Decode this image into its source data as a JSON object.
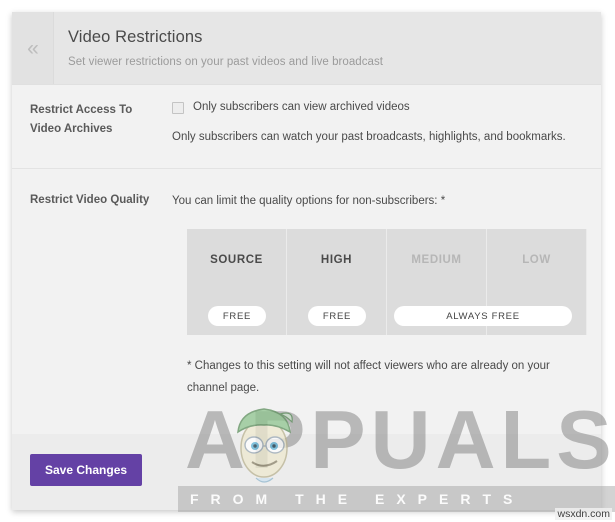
{
  "panel": {
    "title": "Video Restrictions",
    "subtitle": "Set viewer restrictions on your past videos and live broadcast",
    "collapse_icon": "double-chevron-left",
    "collapse_glyph": "«"
  },
  "sections": {
    "archives": {
      "label": "Restrict Access To Video Archives",
      "checkbox_label": "Only subscribers can view archived videos",
      "checkbox_checked": false,
      "help_text": "Only subscribers can watch your past broadcasts, highlights, and bookmarks."
    },
    "quality": {
      "label": "Restrict Video Quality",
      "intro": "You can limit the quality options for non-subscribers: *",
      "columns": [
        {
          "name": "SOURCE",
          "dimmed": false
        },
        {
          "name": "HIGH",
          "dimmed": false
        },
        {
          "name": "MEDIUM",
          "dimmed": true
        },
        {
          "name": "LOW",
          "dimmed": true
        }
      ],
      "pills": [
        {
          "label": "FREE",
          "span": "SOURCE"
        },
        {
          "label": "FREE",
          "span": "HIGH"
        },
        {
          "label": "ALWAYS FREE",
          "span": "MEDIUM+LOW"
        }
      ],
      "footnote": "* Changes to this setting will not affect viewers who are already on your channel page."
    }
  },
  "footer": {
    "save_label": "Save Changes",
    "save_color": "#6441a5"
  },
  "watermark": {
    "word": "APPUALS",
    "tagline": "FROM THE EXPERTS",
    "source": "wsxdn.com"
  }
}
